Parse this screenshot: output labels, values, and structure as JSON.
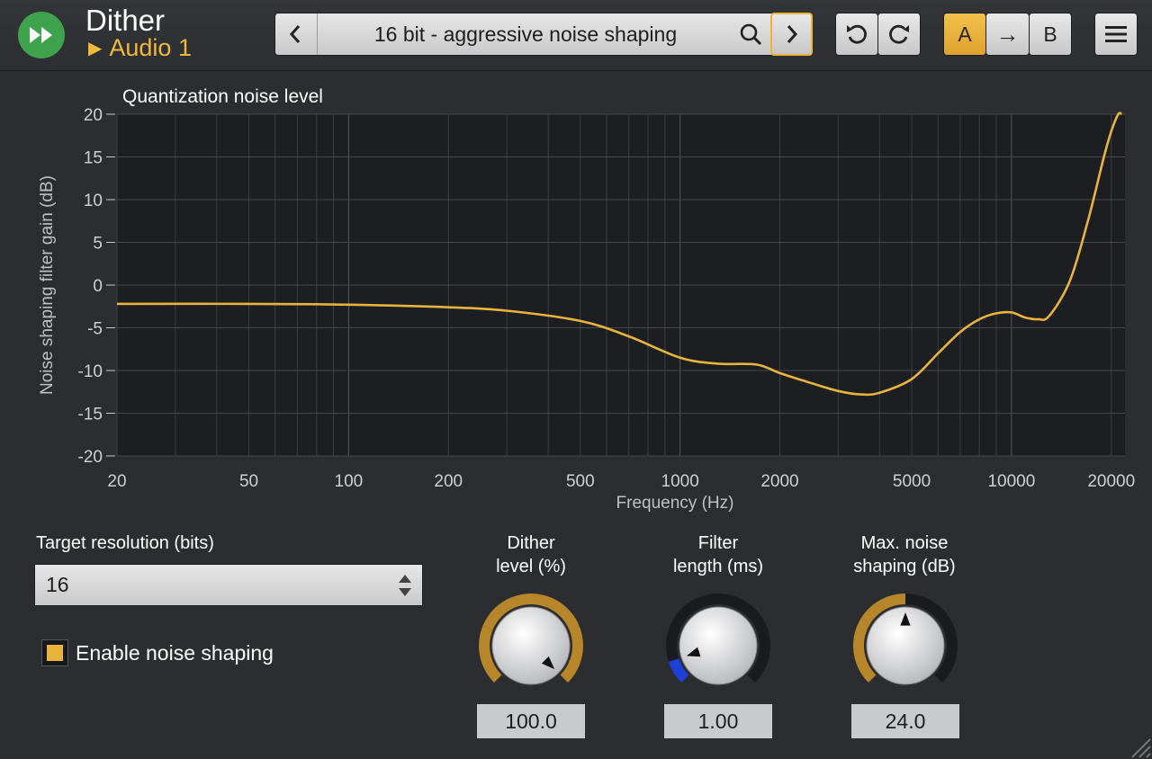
{
  "header": {
    "app_title": "Dither",
    "instance_name": "Audio 1",
    "preset_name": "16 bit - aggressive noise shaping",
    "ab_a_label": "A",
    "ab_arrow_label": "→",
    "ab_b_label": "B"
  },
  "chart_data": {
    "type": "line",
    "title": "Quantization noise level",
    "xlabel": "Frequency (Hz)",
    "ylabel": "Noise shaping filter gain (dB)",
    "x_scale": "log",
    "xlim": [
      20,
      22000
    ],
    "ylim": [
      -20,
      20
    ],
    "x_ticks": [
      20,
      50,
      100,
      200,
      500,
      1000,
      2000,
      5000,
      10000,
      20000
    ],
    "x_tick_labels": [
      "20",
      "50",
      "100",
      "200",
      "500",
      "1000",
      "2000",
      "5000",
      "10000",
      "20000"
    ],
    "y_ticks": [
      20,
      15,
      10,
      5,
      0,
      -5,
      -10,
      -15,
      -20
    ],
    "y_tick_labels": [
      "20",
      "15",
      "10",
      "5",
      "0",
      "-5",
      "-10",
      "-15",
      "-20"
    ],
    "grid": true,
    "series": [
      {
        "color": "#e8b43c",
        "x": [
          20,
          50,
          100,
          200,
          300,
          500,
          700,
          1000,
          1300,
          1700,
          2000,
          2500,
          3000,
          3500,
          4000,
          5000,
          6000,
          7000,
          8000,
          9000,
          10000,
          11000,
          12000,
          13000,
          15000,
          17000,
          19000,
          20000,
          21000,
          21500
        ],
        "values": [
          -2.2,
          -2.2,
          -2.3,
          -2.6,
          -3.0,
          -4.2,
          -6.0,
          -8.5,
          -9.2,
          -9.3,
          -10.3,
          -11.5,
          -12.4,
          -12.8,
          -12.6,
          -11.0,
          -8.0,
          -5.5,
          -4.0,
          -3.3,
          -3.2,
          -3.8,
          -4.0,
          -3.6,
          0.5,
          7.5,
          15.0,
          18.0,
          20.0,
          20.0
        ]
      }
    ]
  },
  "controls": {
    "target_resolution_label": "Target resolution (bits)",
    "target_resolution_value": "16",
    "noise_shaping_label": "Enable noise shaping",
    "noise_shaping_checked": true,
    "dither_level_label": "Dither\nlevel (%)",
    "dither_level_value": "100.0",
    "dither_level_fraction": 1.0,
    "filter_length_label": "Filter\nlength (ms)",
    "filter_length_value": "1.00",
    "filter_length_fraction": 0.1,
    "max_noise_shaping_label": "Max. noise\nshaping (dB)",
    "max_noise_shaping_value": "24.0",
    "max_noise_shaping_fraction": 0.5
  },
  "colors": {
    "accent": "#e8b43c",
    "logo_green": "#3fa34d",
    "filter_arc_blue": "#1f3fd6"
  }
}
